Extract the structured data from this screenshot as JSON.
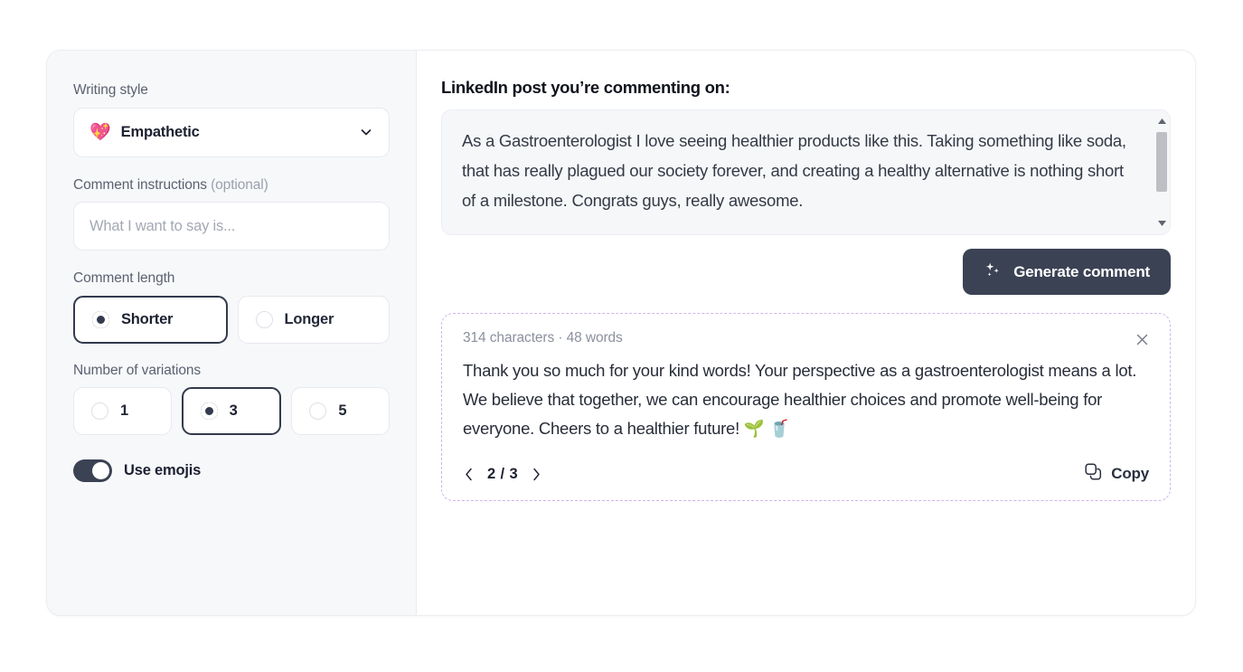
{
  "sidebar": {
    "writing_style": {
      "label": "Writing style",
      "emoji": "💖",
      "value": "Empathetic",
      "chevron_icon": "chevron-down-icon"
    },
    "instructions": {
      "label": "Comment instructions ",
      "label_muted": "(optional)",
      "placeholder": "What I want to say is...",
      "value": ""
    },
    "comment_length": {
      "label": "Comment length",
      "options": [
        {
          "label": "Shorter",
          "selected": true
        },
        {
          "label": "Longer",
          "selected": false
        }
      ]
    },
    "variations": {
      "label": "Number of variations",
      "options": [
        {
          "label": "1",
          "selected": false
        },
        {
          "label": "3",
          "selected": true
        },
        {
          "label": "5",
          "selected": false
        }
      ]
    },
    "emojis_toggle": {
      "label": "Use emojis",
      "on": true
    }
  },
  "main": {
    "title": "LinkedIn post you’re commenting on:",
    "post_text": "As a Gastroenterologist I love seeing healthier products like this. Taking something like soda, that has really plagued our society forever, and creating a healthy alternative is nothing short of a milestone. Congrats guys, really awesome.",
    "generate_button": {
      "label": "Generate comment",
      "icon": "sparkles-icon"
    },
    "result": {
      "meta": "314 characters · 48 words",
      "close_icon": "close-icon",
      "text": "Thank you so much for your kind words! Your perspective as a gastroenterologist means a lot. We believe that together, we can encourage healthier choices and promote well-being for everyone. Cheers to a healthier future! 🌱 🥤",
      "pager": {
        "prev_icon": "chevron-left-icon",
        "count": "2 / 3",
        "next_icon": "chevron-right-icon"
      },
      "copy": {
        "label": "Copy",
        "icon": "copy-icon"
      }
    }
  },
  "colors": {
    "accent_dark": "#3b4254",
    "dashed_border": "#cdb6ef",
    "sidebar_bg": "#f7f8fa",
    "post_bg": "#f6f7f9"
  }
}
